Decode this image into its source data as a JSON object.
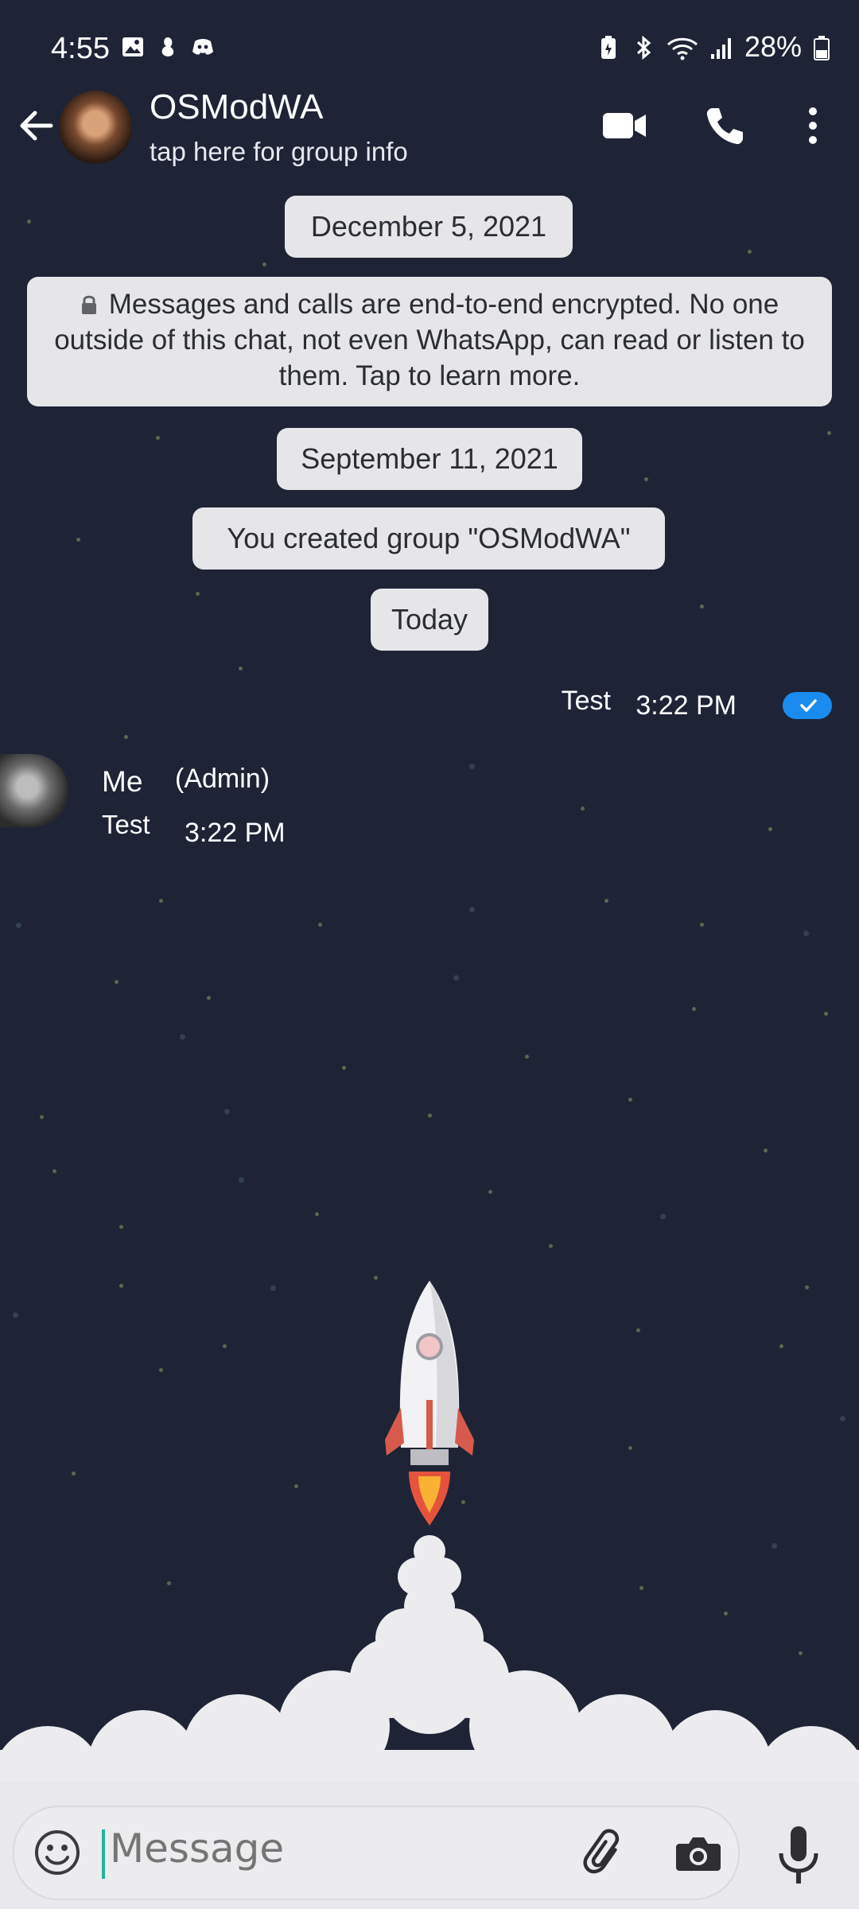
{
  "status_bar": {
    "time": "4:55",
    "battery": "28%",
    "left_icons": [
      "gallery-icon",
      "app-icon",
      "discord-icon"
    ],
    "right_icons": [
      "battery-saver-icon",
      "bluetooth-icon",
      "wifi-icon",
      "signal-icon",
      "battery-icon"
    ]
  },
  "header": {
    "title": "OSModWA",
    "subtitle": "tap here for group info",
    "actions": [
      "video-call-icon",
      "voice-call-icon",
      "more-options-icon"
    ]
  },
  "chat": {
    "date_1": "December 5, 2021",
    "encryption_notice": "Messages and calls are end-to-end encrypted. No one outside of this chat, not even WhatsApp, can read or listen to them. Tap to learn more.",
    "date_2": "September 11, 2021",
    "group_created": "You created group \"OSModWA\"",
    "date_3": "Today",
    "outgoing": {
      "text": "Test",
      "time": "3:22 PM"
    },
    "incoming": {
      "sender": "Me",
      "role": "(Admin)",
      "text": "Test",
      "time": "3:22 PM"
    }
  },
  "composer": {
    "placeholder": "Message",
    "icons": [
      "emoji-icon",
      "attach-icon",
      "camera-icon",
      "mic-icon"
    ]
  },
  "colors": {
    "background": "#1e2436",
    "system_bubble": "#e6e6e9",
    "tick_badge": "#1a8cf0",
    "caret": "#23b39b"
  }
}
